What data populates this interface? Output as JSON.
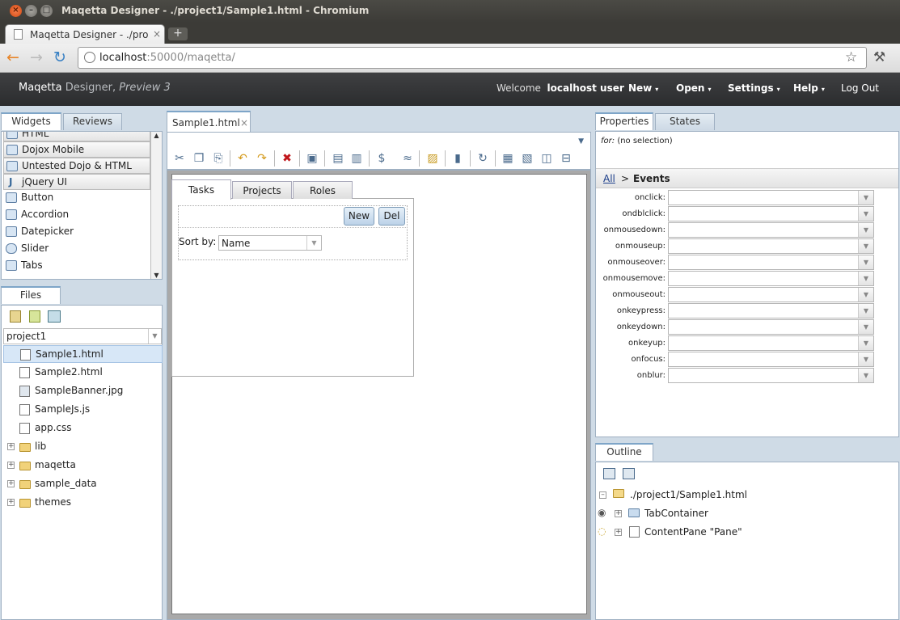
{
  "window": {
    "title": "Maqetta Designer - ./project1/Sample1.html - Chromium",
    "close": "×",
    "min": "–",
    "max": "□"
  },
  "browser_tab": {
    "title": "Maqetta Designer - ./pro",
    "close": "×"
  },
  "url": {
    "host": "localhost",
    "rest": ":50000/maqetta/"
  },
  "header": {
    "brand_1": "Maqetta",
    "brand_2": " Designer, ",
    "brand_3": "Preview 3",
    "welcome": "Welcome",
    "user": "localhost user",
    "menus": [
      "New",
      "Open",
      "Settings",
      "Help"
    ],
    "logout": "Log Out"
  },
  "left_panel": {
    "tabs": [
      "Widgets",
      "Reviews"
    ],
    "widgets": [
      {
        "label": "HTML",
        "category": true
      },
      {
        "label": "Dojox Mobile",
        "category": true
      },
      {
        "label": "Untested Dojo & HTML",
        "category": true
      },
      {
        "label": "jQuery UI",
        "category": true
      },
      {
        "label": "Button",
        "category": false
      },
      {
        "label": "Accordion",
        "category": false
      },
      {
        "label": "Datepicker",
        "category": false
      },
      {
        "label": "Slider",
        "category": false
      },
      {
        "label": "Tabs",
        "category": false
      }
    ]
  },
  "files": {
    "tab": "Files",
    "project": "project1",
    "items": [
      "Sample1.html",
      "Sample2.html",
      "SampleBanner.jpg",
      "SampleJs.js",
      "app.css"
    ],
    "folders": [
      "lib",
      "maqetta",
      "sample_data",
      "themes"
    ]
  },
  "editor": {
    "tab": "Sample1.html",
    "tab_close": "×",
    "canvas": {
      "tabs": [
        "Tasks",
        "Projects",
        "Roles"
      ],
      "new_label": "New",
      "del_label": "Del",
      "sort_label": "Sort by:",
      "sort_value": "Name"
    }
  },
  "properties": {
    "tabs": [
      "Properties",
      "States"
    ],
    "for_label": "for:",
    "for_value": "(no selection)",
    "crumb_all": "All",
    "crumb_sep": ">",
    "crumb_current": "Events",
    "events": [
      "onclick:",
      "ondblclick:",
      "onmousedown:",
      "onmouseup:",
      "onmouseover:",
      "onmousemove:",
      "onmouseout:",
      "onkeypress:",
      "onkeydown:",
      "onkeyup:",
      "onfocus:",
      "onblur:"
    ]
  },
  "outline": {
    "tab": "Outline",
    "root": "./project1/Sample1.html",
    "items": [
      "TabContainer",
      "ContentPane \"Pane\""
    ]
  },
  "colors": {
    "accent": "#7ea5c8",
    "header": "#2b2c2e",
    "panel_bg": "#cfdbe6"
  }
}
